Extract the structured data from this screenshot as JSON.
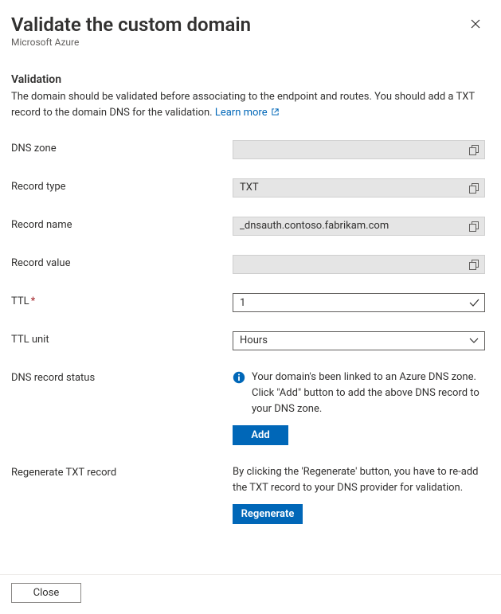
{
  "header": {
    "title": "Validate the custom domain",
    "subtitle": "Microsoft Azure"
  },
  "validation": {
    "heading": "Validation",
    "description_part1": "The domain should be validated before associating to the endpoint and routes. You should add a TXT record to the domain DNS for the validation. ",
    "learn_more_label": "Learn more"
  },
  "fields": {
    "dns_zone": {
      "label": "DNS zone",
      "value": ""
    },
    "record_type": {
      "label": "Record type",
      "value": "TXT"
    },
    "record_name": {
      "label": "Record name",
      "value": "_dnsauth.contoso.fabrikam.com"
    },
    "record_value": {
      "label": "Record value",
      "value": ""
    },
    "ttl": {
      "label": "TTL",
      "value": "1",
      "required": true
    },
    "ttl_unit": {
      "label": "TTL unit",
      "value": "Hours"
    }
  },
  "dns_status": {
    "label": "DNS record status",
    "message": "Your domain's been linked to an Azure DNS zone. Click \"Add\" button to add the above DNS record to your DNS zone.",
    "add_button": "Add"
  },
  "regenerate": {
    "label": "Regenerate TXT record",
    "message": "By clicking the 'Regenerate' button, you have to re-add the TXT record to your DNS provider for validation.",
    "button": "Regenerate"
  },
  "footer": {
    "close_button": "Close"
  }
}
